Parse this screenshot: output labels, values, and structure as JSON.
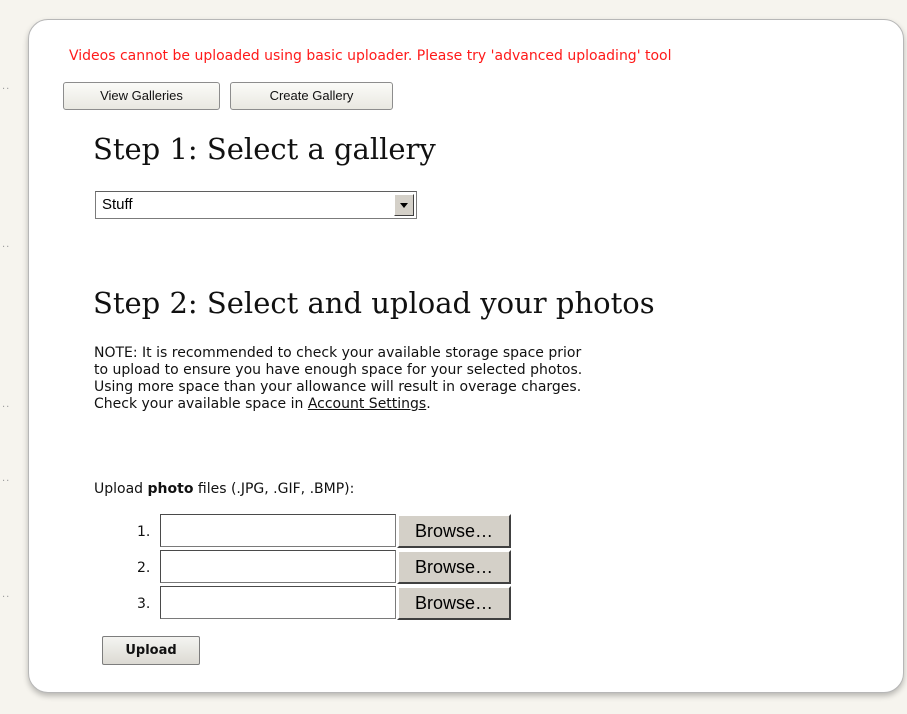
{
  "warning": "Videos cannot be uploaded using basic uploader. Please try 'advanced uploading' tool",
  "buttons": {
    "view_galleries": "View Galleries",
    "create_gallery": "Create Gallery"
  },
  "step1": {
    "title": "Step 1: Select a gallery",
    "selected_gallery": "Stuff"
  },
  "step2": {
    "title": "Step 2: Select and upload your photos",
    "note_line1": "NOTE: It is recommended to check your available storage space prior",
    "note_line2": "to upload to ensure you have enough space for your selected photos.",
    "note_line3": "Using more space than your allowance will result in overage charges.",
    "note_prefix": "Check your available space in ",
    "note_link": "Account Settings",
    "note_suffix": "."
  },
  "upload": {
    "label_prefix": "Upload ",
    "label_bold": "photo",
    "label_suffix": " files (.JPG, .GIF, .BMP):",
    "rows": [
      {
        "number": "1.",
        "browse_label": "Browse…"
      },
      {
        "number": "2.",
        "browse_label": "Browse…"
      },
      {
        "number": "3.",
        "browse_label": "Browse…"
      }
    ],
    "submit_label": "Upload"
  },
  "icons": {
    "dropdown_arrow": "chevron-down-icon"
  },
  "colors": {
    "warning": "#ff1a1a",
    "button_face": "#d4d0c8"
  }
}
